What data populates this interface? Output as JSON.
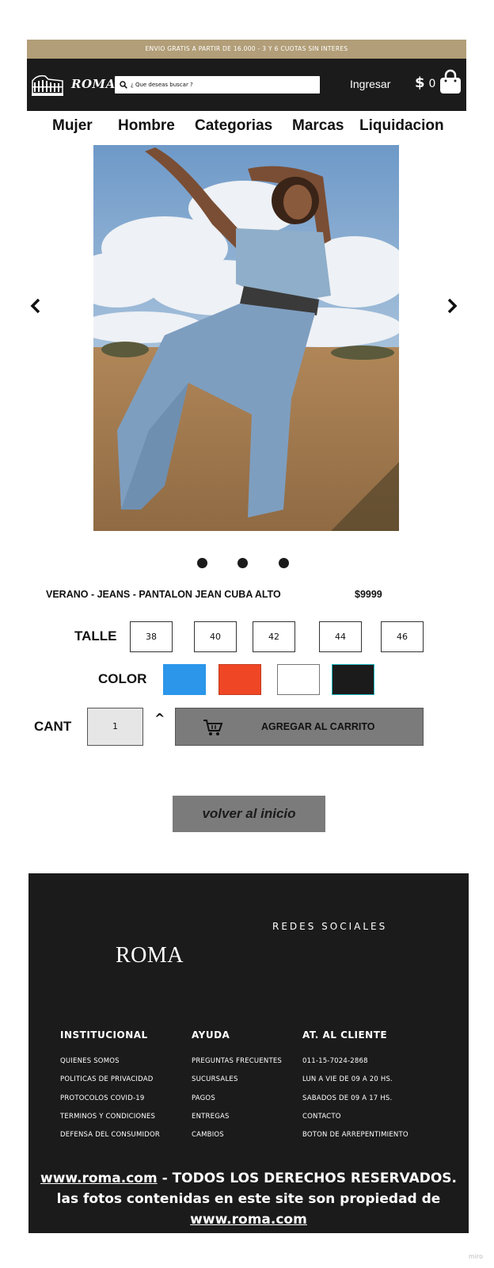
{
  "promo": {
    "text": "ENVIO GRATIS A PARTIR DE 16.000 - 3 Y 6 CUOTAS SIN INTERES"
  },
  "header": {
    "brand": "ROMA",
    "search_placeholder": "¿ Que deseas buscar ?",
    "login": "Ingresar",
    "cart_currency": "$",
    "cart_count": "0"
  },
  "nav": {
    "items": [
      {
        "label": "Mujer"
      },
      {
        "label": "Hombre"
      },
      {
        "label": "Categorias"
      },
      {
        "label": "Marcas"
      },
      {
        "label": "Liquidacion"
      }
    ]
  },
  "carousel": {
    "slide_count": 3,
    "active_slide": 1
  },
  "product": {
    "title": "VERANO - JEANS - PANTALON JEAN CUBA ALTO",
    "price": "$9999",
    "size_label": "TALLE",
    "sizes": [
      "38",
      "40",
      "42",
      "44",
      "46"
    ],
    "color_label": "COLOR",
    "colors": [
      "#2b96ea",
      "#ef4726",
      "#ffffff",
      "#1b1b1b"
    ],
    "qty_label": "CANT",
    "qty_value": "1",
    "qty_up": "^",
    "add_to_cart": "AGREGAR AL CARRITO"
  },
  "back_button": "volver al inicio",
  "footer": {
    "social_title": "REDES SOCIALES",
    "brand": "ROMA",
    "columns": [
      {
        "title": "INSTITUCIONAL",
        "links": [
          "QUIENES SOMOS",
          "POLITICAS DE PRIVACIDAD",
          "PROTOCOLOS COVID-19",
          "TERMINOS Y CONDICIONES",
          "DEFENSA DEL CONSUMIDOR"
        ]
      },
      {
        "title": "AYUDA",
        "links": [
          "PREGUNTAS FRECUENTES",
          "SUCURSALES",
          "PAGOS",
          "ENTREGAS",
          "CAMBIOS"
        ]
      },
      {
        "title": "AT. AL CLIENTE",
        "links": [
          "011-15-7024-2868",
          "LUN A VIE DE 09 A 20 HS.",
          "SABADOS DE 09 A 17 HS.",
          "CONTACTO",
          "BOTON DE ARREPENTIMIENTO"
        ]
      }
    ],
    "copyright_link": "www.roma.com",
    "copyright_text": " - TODOS LOS DERECHOS RESERVADOS. las fotos contenidas en este site son propiedad de ",
    "copyright_link2": "www.roma.com"
  },
  "watermark": "miro"
}
